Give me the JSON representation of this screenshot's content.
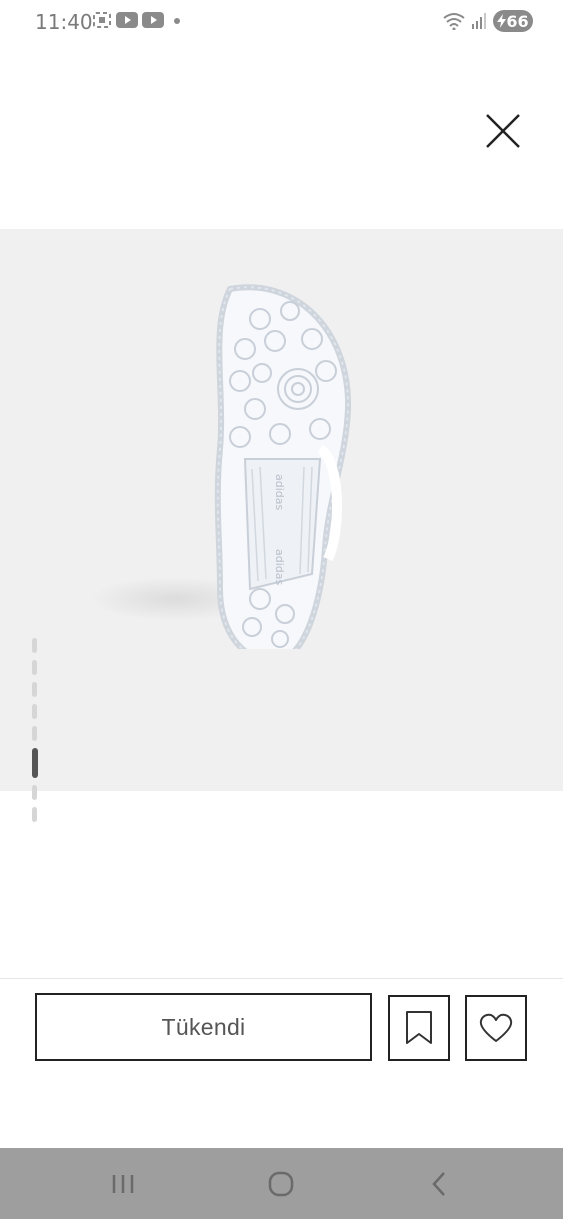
{
  "status_bar": {
    "time": "11:40",
    "battery": "66",
    "icons": [
      "screenshot-icon",
      "youtube-icon",
      "youtube-icon",
      "wifi-icon",
      "signal-icon",
      "battery-charging-icon"
    ]
  },
  "product": {
    "image_alt": "adidas sneaker sole",
    "pager": {
      "total": 9,
      "active_index": 6
    }
  },
  "actions": {
    "soldout_label": "Tükendi",
    "bookmark_icon": "bookmark-icon",
    "wishlist_icon": "heart-icon"
  },
  "navigation": {
    "icons": [
      "recent-apps-icon",
      "home-icon",
      "back-icon"
    ]
  },
  "colors": {
    "image_background": "#f0f0f0",
    "nav_bar": "#9e9e9e",
    "border": "#222222"
  }
}
